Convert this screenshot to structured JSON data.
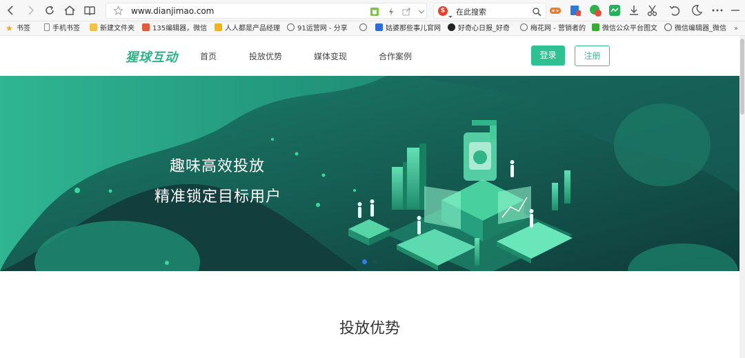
{
  "browser": {
    "url": "www.dianjimao.com",
    "search_placeholder": "在此搜索",
    "search_engine_letter": "S"
  },
  "bookmarks": [
    {
      "label": "书签",
      "color": "#f4a62a"
    },
    {
      "label": "手机书签",
      "color": "#888888"
    },
    {
      "label": "新建文件夹",
      "color": "#f0c24a"
    },
    {
      "label": "135编辑器，微信",
      "color": "#e15b3c"
    },
    {
      "label": "人人都是产品经理",
      "color": "#f2b21a"
    },
    {
      "label": "91运营网 - 分享",
      "color": "#666666"
    },
    {
      "label": "",
      "color": "#666666"
    },
    {
      "label": "姑婆那些事儿官网",
      "color": "#2f6cd8"
    },
    {
      "label": "好奇心日报_好奇",
      "color": "#222222"
    },
    {
      "label": "梅花网 - 营销者的",
      "color": "#666666"
    },
    {
      "label": "微信公众平台图文",
      "color": "#3aa935"
    },
    {
      "label": "微信编辑器_微信",
      "color": "#555555"
    }
  ],
  "site": {
    "logo": "猩球互动",
    "nav": [
      "首页",
      "投放优势",
      "媒体变现",
      "合作案例"
    ],
    "login": "登录",
    "register": "注册"
  },
  "banner": {
    "line1": "趣味高效投放",
    "line2": "精准锁定目标用户",
    "active_slide": 1,
    "slide_count": 2
  },
  "section": {
    "title": "投放优势"
  },
  "colors": {
    "accent": "#2fc191",
    "banner_dark": "#0f3a39",
    "banner_teal": "#1f9e7f"
  }
}
